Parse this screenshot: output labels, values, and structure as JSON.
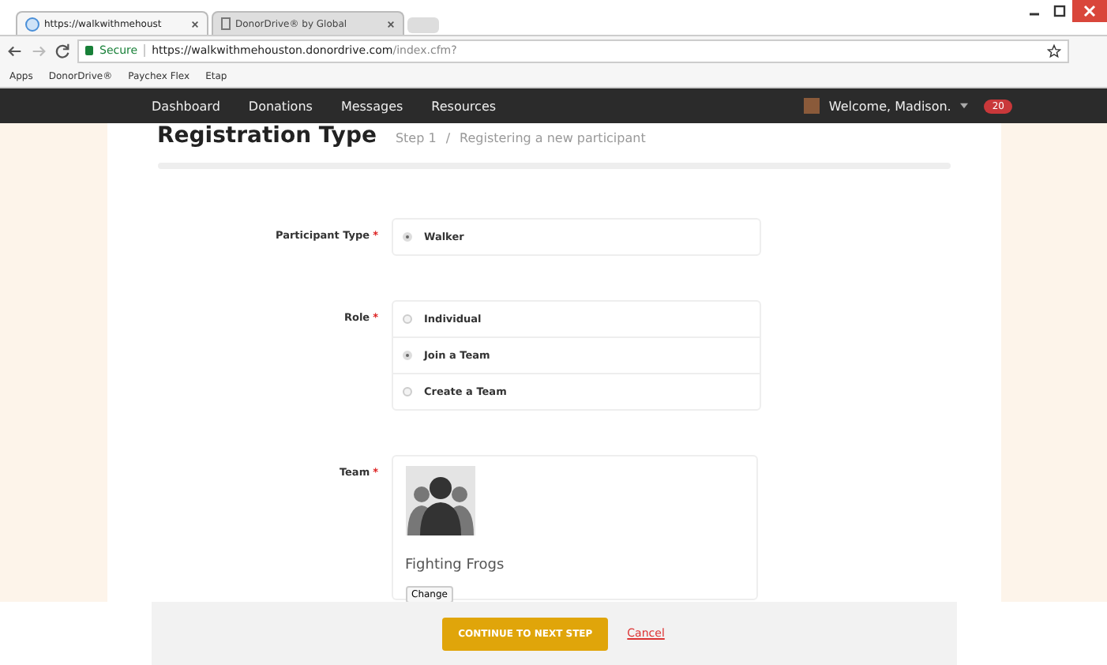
{
  "browser": {
    "tabs": [
      {
        "title": "https://walkwithmehoust",
        "selected": true
      },
      {
        "title": "DonorDrive® by Global",
        "selected": false
      }
    ],
    "secure_label": "Secure",
    "url_host": "https://walkwithmehouston.donordrive.com",
    "url_path": "/index.cfm?",
    "bookmarks": [
      "Apps",
      "DonorDrive®",
      "Paychex Flex",
      "Etap"
    ]
  },
  "nav": {
    "items": [
      "Dashboard",
      "Donations",
      "Messages",
      "Resources"
    ],
    "welcome": "Welcome, Madison.",
    "badge": "20"
  },
  "header": {
    "title": "Registration Type",
    "step": "Step 1",
    "separator": "/",
    "subtitle": "Registering a new participant"
  },
  "participant_type": {
    "label": "Participant Type",
    "required_mark": "*",
    "options": [
      {
        "label": "Walker",
        "selected": true
      }
    ]
  },
  "role": {
    "label": "Role",
    "required_mark": "*",
    "options": [
      {
        "label": "Individual",
        "selected": false
      },
      {
        "label": "Join a Team",
        "selected": true
      },
      {
        "label": "Create a Team",
        "selected": false
      }
    ]
  },
  "team": {
    "label": "Team",
    "required_mark": "*",
    "name": "Fighting Frogs",
    "change_button": "Change"
  },
  "footer": {
    "continue_button": "CONTINUE TO NEXT STEP",
    "cancel_link": "Cancel"
  }
}
